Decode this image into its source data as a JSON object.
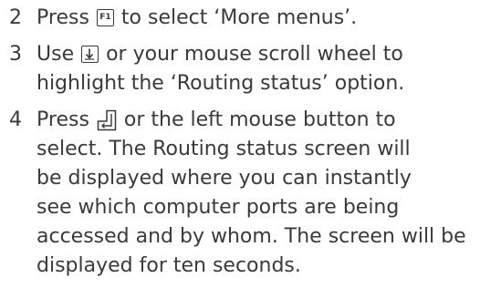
{
  "steps": [
    {
      "number": "2",
      "lines": [
        {
          "before": "Press ",
          "key": "F1",
          "after": " to select ‘More menus’."
        }
      ]
    },
    {
      "number": "3",
      "lines": [
        {
          "before": "Use ",
          "key": "down-arrow-key",
          "after": " or your mouse scroll wheel to"
        },
        {
          "text": "highlight the ‘Routing status’ option."
        }
      ]
    },
    {
      "number": "4",
      "lines": [
        {
          "before": "Press ",
          "key": "enter-key",
          "after": " or the left mouse button to"
        },
        {
          "text": "select. The Routing status screen will"
        },
        {
          "text": "be displayed where you can instantly"
        },
        {
          "text": "see which computer ports are being"
        },
        {
          "text": "accessed and by whom. The screen will be"
        },
        {
          "text": "displayed for ten seconds."
        }
      ]
    }
  ]
}
